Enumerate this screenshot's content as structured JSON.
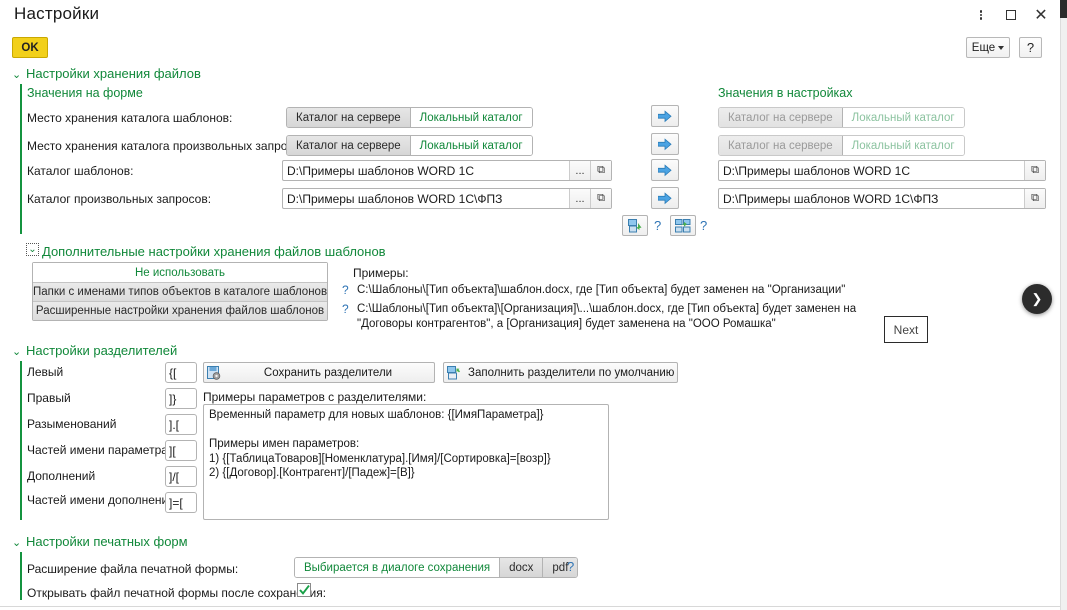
{
  "window": {
    "title": "Настройки",
    "controls": {
      "kebab": "more-vertical",
      "maximize": "maximize",
      "close": "close"
    }
  },
  "commandbar": {
    "ok_label": "OK",
    "more_label": "Еще",
    "help_label": "?"
  },
  "groups": {
    "file_storage": {
      "title": "Настройки хранения файлов",
      "form_values_caption": "Значения на форме",
      "settings_values_caption": "Значения в настройках",
      "rows": [
        {
          "label": "Место хранения каталога шаблонов:",
          "type": "segmented",
          "options": [
            "Каталог на сервере",
            "Локальный каталог"
          ],
          "selected": "Каталог на сервере"
        },
        {
          "label": "Место хранения каталога произвольных запросов:",
          "type": "segmented",
          "options": [
            "Каталог на сервере",
            "Локальный каталог"
          ],
          "selected": "Каталог на сервере"
        },
        {
          "label": "Каталог шаблонов:",
          "type": "path",
          "value": "D:\\Примеры шаблонов WORD 1C",
          "settings_value": "D:\\Примеры шаблонов WORD 1C",
          "browse_label": "...",
          "open_label": "⧉"
        },
        {
          "label": "Каталог произвольных запросов:",
          "type": "path",
          "value": "D:\\Примеры шаблонов WORD 1C\\ФПЗ",
          "settings_value": "D:\\Примеры шаблонов WORD 1C\\ФПЗ",
          "browse_label": "...",
          "open_label": "⧉"
        }
      ],
      "copy_arrow_icon": "blue-right-arrow",
      "transfer_buttons": [
        {
          "icon": "copy-single-icon",
          "help": "?"
        },
        {
          "icon": "copy-all-icon",
          "help": "?"
        }
      ]
    },
    "additional_storage": {
      "title": "Дополнительные настройки хранения файлов шаблонов",
      "options": [
        "Не использовать",
        "Папки с именами типов объектов в каталоге шаблонов",
        "Расширенные настройки хранения файлов шаблонов"
      ],
      "selected": "Не использовать",
      "examples_title": "Примеры:",
      "examples": [
        "C:\\Шаблоны\\[Тип объекта]\\шаблон.docx, где [Тип объекта] будет заменен на \"Организации\"",
        "C:\\Шаблоны\\[Тип объекта]\\[Организация]\\...\\шаблон.docx, где [Тип объекта] будет заменен на \"Договоры контрагентов\", а [Организация] будет заменена на \"ООО Ромашка\""
      ],
      "example_marker": "?"
    },
    "separators": {
      "title": "Настройки разделителей",
      "fields": [
        {
          "label": "Левый",
          "value": "{["
        },
        {
          "label": "Правый",
          "value": "]}"
        },
        {
          "label": "Разыменований",
          "value": "].["
        },
        {
          "label": "Частей имени параметра",
          "value": "]["
        },
        {
          "label": "Дополнений",
          "value": "]/["
        },
        {
          "label": "Частей имени дополнения",
          "value": "]=["
        }
      ],
      "save_button": "Сохранить разделители",
      "save_button_icon": "save-separators-icon",
      "fill_default_button": "Заполнить разделители по умолчанию",
      "fill_default_icon": "fill-default-icon",
      "examples_label": "Примеры параметров с разделителями:",
      "examples_text": "Временный параметр для новых шаблонов: {[ИмяПараметра]}\n\nПримеры имен параметров:\n1) {[ТаблицаТоваров][Номенклатура].[Имя]/[Сортировка]=[возр]}\n2) {[Договор].[Контрагент]/[Падеж]=[В]}"
    },
    "print_forms": {
      "title": "Настройки печатных форм",
      "extension_label": "Расширение файла печатной формы:",
      "extension_options": [
        "Выбирается в диалоге сохранения",
        "docx",
        "pdf"
      ],
      "extension_selected": "Выбирается в диалоге сохранения",
      "extension_help": "?",
      "open_after_save_label": "Открывать файл печатной формы после сохранения:",
      "open_after_save_checked": true
    }
  },
  "overlay": {
    "next_button": "Next",
    "fab_icon": "chevron-right-icon"
  },
  "colors": {
    "accent_green": "#11883a",
    "ok_yellow": "#f2d01a",
    "link_blue": "#2e74b5",
    "arrow_blue": "#3a93d8"
  }
}
